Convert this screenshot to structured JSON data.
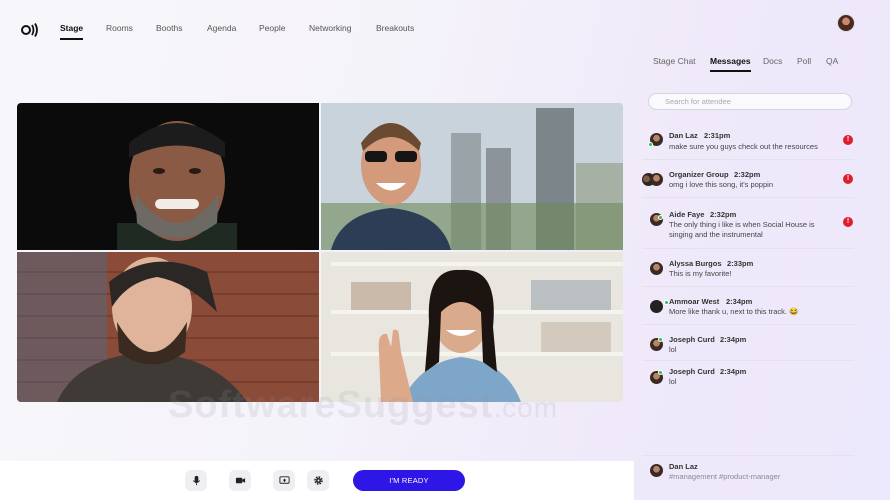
{
  "nav": {
    "items": [
      {
        "label": "Stage",
        "active": true
      },
      {
        "label": "Rooms",
        "active": false
      },
      {
        "label": "Booths",
        "active": false
      },
      {
        "label": "Agenda",
        "active": false
      },
      {
        "label": "People",
        "active": false
      },
      {
        "label": "Networking",
        "active": false
      },
      {
        "label": "Breakouts",
        "active": false
      }
    ]
  },
  "panel": {
    "tabs": [
      {
        "label": "Stage Chat",
        "active": false
      },
      {
        "label": "Messages",
        "active": true
      },
      {
        "label": "Docs",
        "active": false
      },
      {
        "label": "Poll",
        "active": false
      },
      {
        "label": "QA",
        "active": false
      }
    ],
    "search_placeholder": "Search for attendee",
    "messages": [
      {
        "name": "Dan Laz",
        "time": "2:31pm",
        "text": "make sure you guys check out the resources",
        "unread": "!",
        "online": true
      },
      {
        "name": "Organizer Group",
        "time": "2:32pm",
        "text": "omg i love this song, it's poppin",
        "unread": "!",
        "online": false
      },
      {
        "name": "Aide Faye",
        "time": "2:32pm",
        "text": "The only thing i like is when Social House is singing and the instrumental",
        "unread": "!",
        "online": true
      },
      {
        "name": "Alyssa Burgos",
        "time": "2:33pm",
        "text": "This is my favorite!",
        "unread": "",
        "online": false
      },
      {
        "name": "Ammoar West",
        "time": "2:34pm",
        "text": "More like thank u, next to this track. 😂",
        "unread": "",
        "online": true
      },
      {
        "name": "Joseph Curd",
        "time": "2:34pm",
        "text": "lol",
        "unread": "",
        "online": true
      },
      {
        "name": "Joseph Curd",
        "time": "2:34pm",
        "text": "lol",
        "unread": "",
        "online": true
      }
    ],
    "bottom_message": {
      "name": "Dan Laz",
      "text": "#management #product-manager"
    }
  },
  "controls": {
    "ready_label": "I'M READY",
    "icons": [
      "microphone-icon",
      "camera-icon",
      "screen-share-icon",
      "settings-icon"
    ]
  },
  "watermark": {
    "main": "SoftwareSuggest",
    "suffix": ".com"
  },
  "colors": {
    "accent": "#2d16e6",
    "unread": "#e01e2b",
    "online": "#27c24c"
  }
}
